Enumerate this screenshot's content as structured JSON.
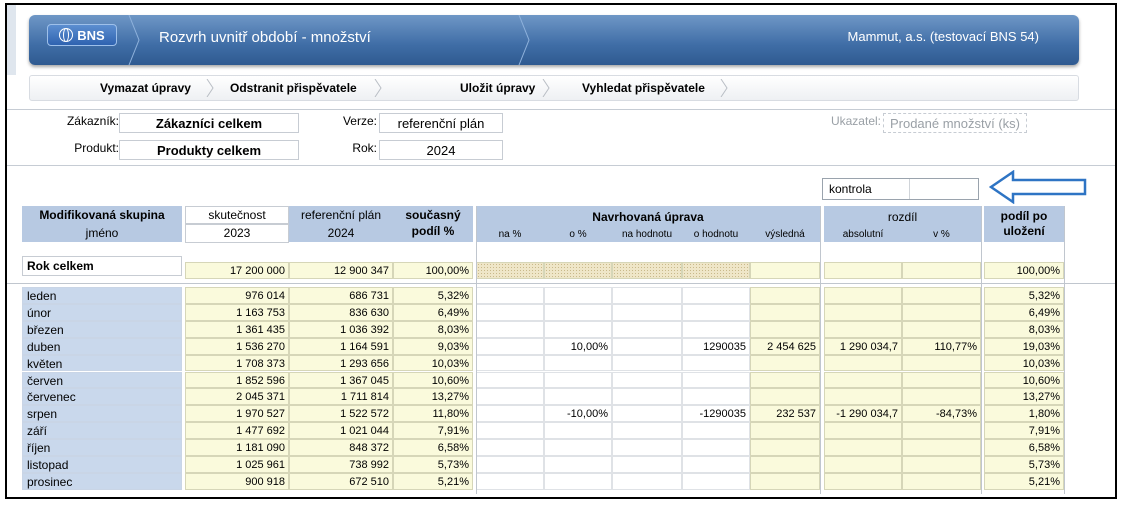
{
  "header": {
    "brand": "BNS",
    "title": "Rozvrh uvnitř období - množství",
    "company": "Mammut, a.s. (testovací BNS 54)"
  },
  "toolbar": {
    "clear": "Vymazat úpravy",
    "remove": "Odstranit přispěvatele",
    "save": "Uložit úpravy",
    "find": "Vyhledat přispěvatele"
  },
  "params": {
    "customer_label": "Zákazník:",
    "customer_value": "Zákazníci celkem",
    "version_label": "Verze:",
    "version_value": "referenční plán",
    "indicator_label": "Ukazatel:",
    "indicator_value": "Prodané množství (ks)",
    "product_label": "Produkt:",
    "product_value": "Produkty celkem",
    "year_label": "Rok:",
    "year_value": "2024"
  },
  "kontrola": {
    "label": "kontrola",
    "value": ""
  },
  "table": {
    "headers": {
      "group": "Modifikovaná skupina",
      "name": "jméno",
      "actual": "skutečnost",
      "actual_year": "2023",
      "plan": "referenční plán",
      "plan_year": "2024",
      "share": "současný",
      "share2": "podíl %",
      "adjust": "Navrhovaná úprava",
      "na_pct": "na %",
      "o_pct": "o %",
      "na_val": "na hodnotu",
      "o_val": "o hodnotu",
      "result": "výsledná",
      "diff": "rozdíl",
      "abs": "absolutní",
      "v_pct": "v %",
      "after": "podíl po",
      "after2": "uložení"
    },
    "total": {
      "label": "Rok celkem",
      "actual": "17 200 000",
      "plan": "12 900 347",
      "share": "100,00%",
      "after": "100,00%"
    },
    "rows": [
      {
        "name": "leden",
        "actual": "976 014",
        "plan": "686 731",
        "share": "5,32%",
        "o_pct": "",
        "o_val": "",
        "result": "",
        "abs": "",
        "v_pct": "",
        "after": "5,32%"
      },
      {
        "name": "únor",
        "actual": "1 163 753",
        "plan": "836 630",
        "share": "6,49%",
        "o_pct": "",
        "o_val": "",
        "result": "",
        "abs": "",
        "v_pct": "",
        "after": "6,49%"
      },
      {
        "name": "březen",
        "actual": "1 361 435",
        "plan": "1 036 392",
        "share": "8,03%",
        "o_pct": "",
        "o_val": "",
        "result": "",
        "abs": "",
        "v_pct": "",
        "after": "8,03%"
      },
      {
        "name": "duben",
        "actual": "1 536 270",
        "plan": "1 164 591",
        "share": "9,03%",
        "o_pct": "10,00%",
        "o_val": "1290035",
        "result": "2 454 625",
        "abs": "1 290 034,7",
        "v_pct": "110,77%",
        "after": "19,03%"
      },
      {
        "name": "květen",
        "actual": "1 708 373",
        "plan": "1 293 656",
        "share": "10,03%",
        "o_pct": "",
        "o_val": "",
        "result": "",
        "abs": "",
        "v_pct": "",
        "after": "10,03%"
      },
      {
        "name": "červen",
        "actual": "1 852 596",
        "plan": "1 367 045",
        "share": "10,60%",
        "o_pct": "",
        "o_val": "",
        "result": "",
        "abs": "",
        "v_pct": "",
        "after": "10,60%"
      },
      {
        "name": "červenec",
        "actual": "2 045 371",
        "plan": "1 711 814",
        "share": "13,27%",
        "o_pct": "",
        "o_val": "",
        "result": "",
        "abs": "",
        "v_pct": "",
        "after": "13,27%"
      },
      {
        "name": "srpen",
        "actual": "1 970 527",
        "plan": "1 522 572",
        "share": "11,80%",
        "o_pct": "-10,00%",
        "o_val": "-1290035",
        "result": "232 537",
        "abs": "-1 290 034,7",
        "v_pct": "-84,73%",
        "after": "1,80%"
      },
      {
        "name": "září",
        "actual": "1 477 692",
        "plan": "1 021 044",
        "share": "7,91%",
        "o_pct": "",
        "o_val": "",
        "result": "",
        "abs": "",
        "v_pct": "",
        "after": "7,91%"
      },
      {
        "name": "říjen",
        "actual": "1 181 090",
        "plan": "848 372",
        "share": "6,58%",
        "o_pct": "",
        "o_val": "",
        "result": "",
        "abs": "",
        "v_pct": "",
        "after": "6,58%"
      },
      {
        "name": "listopad",
        "actual": "1 025 961",
        "plan": "738 992",
        "share": "5,73%",
        "o_pct": "",
        "o_val": "",
        "result": "",
        "abs": "",
        "v_pct": "",
        "after": "5,73%"
      },
      {
        "name": "prosinec",
        "actual": "900 918",
        "plan": "672 510",
        "share": "5,21%",
        "o_pct": "",
        "o_val": "",
        "result": "",
        "abs": "",
        "v_pct": "",
        "after": "5,21%"
      }
    ]
  }
}
